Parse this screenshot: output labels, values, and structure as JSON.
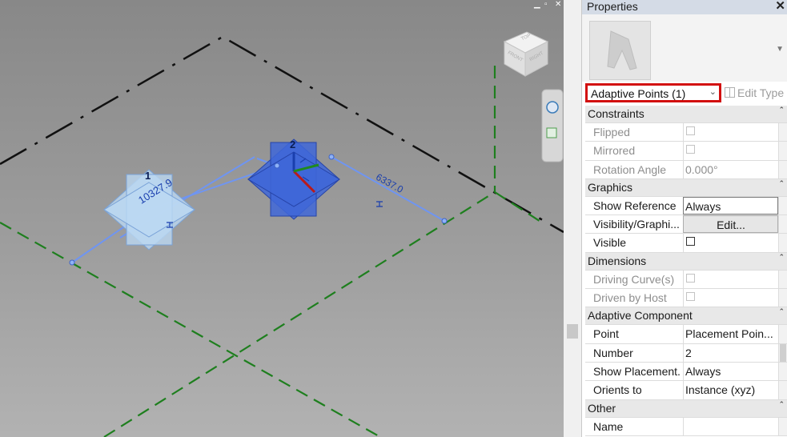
{
  "viewport": {
    "window_controls": [
      "▁",
      "▫",
      "✕"
    ],
    "dimension_values": [
      "10327.9",
      "6337.0"
    ],
    "point_labels": [
      "1",
      "2"
    ]
  },
  "properties": {
    "title": "Properties",
    "close_glyph": "✕",
    "type_selector": {
      "label": "Adaptive Points (1)",
      "chevron": "⌄"
    },
    "edit_type_label": "Edit Type",
    "sections": [
      {
        "name": "Constraints",
        "rows": [
          {
            "label": "Flipped",
            "kind": "checkbox",
            "value": "",
            "disabled": true
          },
          {
            "label": "Mirrored",
            "kind": "checkbox",
            "value": "",
            "disabled": true
          },
          {
            "label": "Rotation Angle",
            "kind": "text",
            "value": "0.000°",
            "disabled": true
          }
        ]
      },
      {
        "name": "Graphics",
        "rows": [
          {
            "label": "Show Reference ...",
            "kind": "boxed",
            "value": "Always",
            "disabled": false
          },
          {
            "label": "Visibility/Graphi...",
            "kind": "button",
            "value": "Edit...",
            "disabled": false
          },
          {
            "label": "Visible",
            "kind": "checkbox",
            "value": "",
            "disabled": false
          }
        ]
      },
      {
        "name": "Dimensions",
        "rows": [
          {
            "label": "Driving Curve(s)",
            "kind": "checkbox",
            "value": "",
            "disabled": true
          },
          {
            "label": "Driven by Host",
            "kind": "checkbox",
            "value": "",
            "disabled": true
          }
        ]
      },
      {
        "name": "Adaptive Component",
        "rows": [
          {
            "label": "Point",
            "kind": "text",
            "value": "Placement Poin...",
            "disabled": false
          },
          {
            "label": "Number",
            "kind": "text",
            "value": "2",
            "disabled": false
          },
          {
            "label": "Show Placement...",
            "kind": "text",
            "value": "Always",
            "disabled": false
          },
          {
            "label": "Orients to",
            "kind": "text",
            "value": "Instance (xyz)",
            "disabled": false
          }
        ]
      },
      {
        "name": "Other",
        "rows": [
          {
            "label": "Name",
            "kind": "text",
            "value": "",
            "disabled": false
          }
        ]
      }
    ]
  },
  "viewcube": {
    "faces": [
      "TOP",
      "FRONT",
      "RIGHT"
    ]
  },
  "colors": {
    "highlight_border": "#d20f0f",
    "blue_point": "#3f67d8",
    "light_point": "#b7d3f0",
    "grid_green": "#1e7f1e"
  }
}
